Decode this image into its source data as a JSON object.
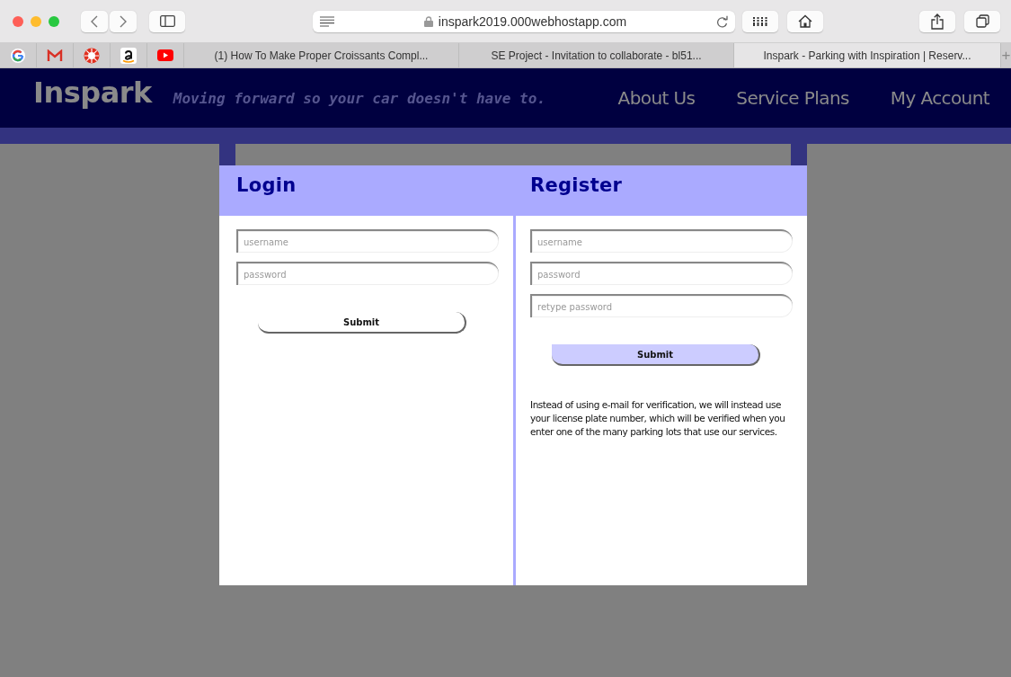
{
  "browser": {
    "address": "inspark2019.000webhostapp.com",
    "bookmarks": [
      {
        "kind": "google"
      },
      {
        "kind": "mail"
      },
      {
        "kind": "sun"
      },
      {
        "kind": "amazon"
      },
      {
        "kind": "video"
      }
    ],
    "tabs": [
      {
        "label": "(1) How To Make Proper Croissants Compl...",
        "selected": false
      },
      {
        "label": "SE Project - Invitation to collaborate - bl51...",
        "selected": false
      },
      {
        "label": "Inspark - Parking with Inspiration | Reserv...",
        "selected": true
      }
    ],
    "new_tab": "+"
  },
  "header": {
    "logo": "Inspark",
    "tagline": "Moving forward so your car doesn't have to.",
    "nav": [
      "About Us",
      "Service Plans",
      "My Account"
    ]
  },
  "modal": {
    "panels": [
      {
        "title": "Login",
        "fields": [
          {
            "placeholder": "username"
          },
          {
            "placeholder": "password"
          }
        ],
        "submit": {
          "label": "Submit",
          "hovered": false
        }
      },
      {
        "title": "Register",
        "fields": [
          {
            "placeholder": "username"
          },
          {
            "placeholder": "password"
          },
          {
            "placeholder": "retype password"
          }
        ],
        "submit": {
          "label": "Submit",
          "hovered": true
        },
        "note": "Instead of using e-mail for verification, we will instead use your license plate number, which will be verified when you enter one of the many parking lots that use our services."
      }
    ]
  }
}
